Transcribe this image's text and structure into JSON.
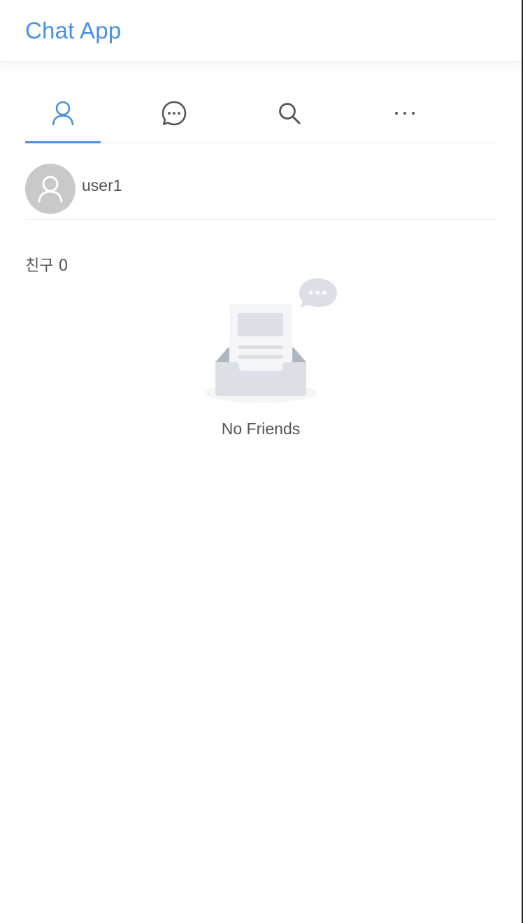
{
  "header": {
    "title": "Chat App"
  },
  "tabs": [
    {
      "name": "friends",
      "icon": "user-icon",
      "active": true
    },
    {
      "name": "chats",
      "icon": "chat-bubble-icon",
      "active": false
    },
    {
      "name": "search",
      "icon": "search-icon",
      "active": false
    },
    {
      "name": "more",
      "icon": "ellipsis-icon",
      "active": false
    }
  ],
  "profile": {
    "username": "user1",
    "avatar_icon": "default-avatar-icon"
  },
  "friends": {
    "count_label": "친구 0",
    "empty_icon": "empty-inbox-icon",
    "empty_label": "No Friends"
  },
  "colors": {
    "accent": "#4a90e2",
    "icon_default": "#555555",
    "avatar_bg": "#c9c9c9",
    "divider": "#e6e6e6"
  }
}
